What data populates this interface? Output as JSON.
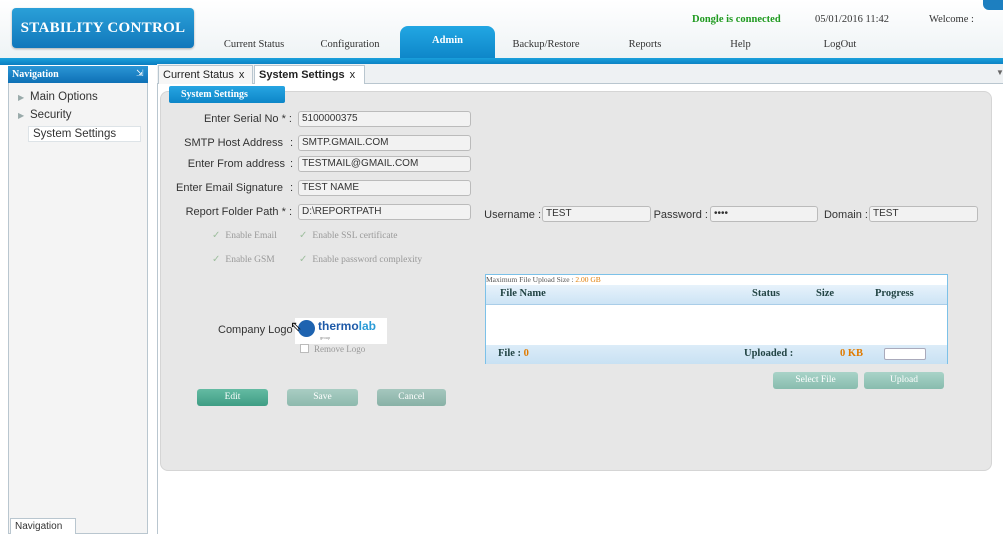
{
  "header": {
    "brand": "STABILITY CONTROL",
    "menu": [
      {
        "label": "Current Status",
        "active": false
      },
      {
        "label": "Configuration",
        "active": false
      },
      {
        "label": "Admin",
        "active": true
      },
      {
        "label": "Backup/Restore",
        "active": false
      },
      {
        "label": "Reports",
        "active": false
      },
      {
        "label": "Help",
        "active": false
      },
      {
        "label": "LogOut",
        "active": false
      }
    ],
    "dongle_status": "Dongle is connected",
    "datetime": "05/01/2016 11:42",
    "welcome": "Welcome :"
  },
  "nav": {
    "title": "Navigation",
    "items": [
      {
        "label": "Main Options"
      },
      {
        "label": "Security"
      },
      {
        "label": "System Settings"
      }
    ],
    "bottom_tab": "Navigation"
  },
  "tabs": [
    {
      "label": "Current Status",
      "close": "x"
    },
    {
      "label": "System Settings",
      "close": "x"
    }
  ],
  "panel": {
    "title": "System Settings",
    "fields": {
      "serial": {
        "label": "Enter Serial No * :",
        "value": "5100000375"
      },
      "smtp": {
        "label": "SMTP Host Address",
        "value": "SMTP.GMAIL.COM"
      },
      "from": {
        "label": "Enter From address",
        "value": "TESTMAIL@GMAIL.COM"
      },
      "signature": {
        "label": "Enter Email Signature",
        "value": "TEST NAME"
      },
      "report_path": {
        "label": "Report Folder Path * :",
        "value": "D:\\REPORTPATH"
      },
      "username": {
        "label": "Username :",
        "value": "TEST"
      },
      "password": {
        "label": "Password :",
        "value": "••••"
      },
      "domain": {
        "label": "Domain :",
        "value": "TEST"
      }
    },
    "checkboxes": {
      "enable_email": "Enable Email",
      "enable_ssl": "Enable SSL certificate",
      "enable_gsm": "Enable GSM",
      "enable_pw_complexity": "Enable password complexity"
    },
    "company_logo_label": "Company Logo",
    "logo": {
      "main": "thermo",
      "accent": "lab",
      "sub": "group"
    },
    "remove_logo": "Remove Logo",
    "upload": {
      "max_size_label": "Maximum File Upload Size :",
      "max_size_value": "2.00 GB",
      "columns": [
        "File Name",
        "Status",
        "Size",
        "Progress"
      ],
      "file_label": "File :",
      "file_count": "0",
      "uploaded_label": "Uploaded :",
      "uploaded_value": "0 KB"
    },
    "buttons": {
      "edit": "Edit",
      "save": "Save",
      "cancel": "Cancel",
      "select_file": "Select File",
      "upload": "Upload"
    }
  },
  "colors": {
    "brand_blue": "#1a8fd0",
    "connected_green": "#1f9a1f",
    "accent_orange": "#e07b00"
  }
}
